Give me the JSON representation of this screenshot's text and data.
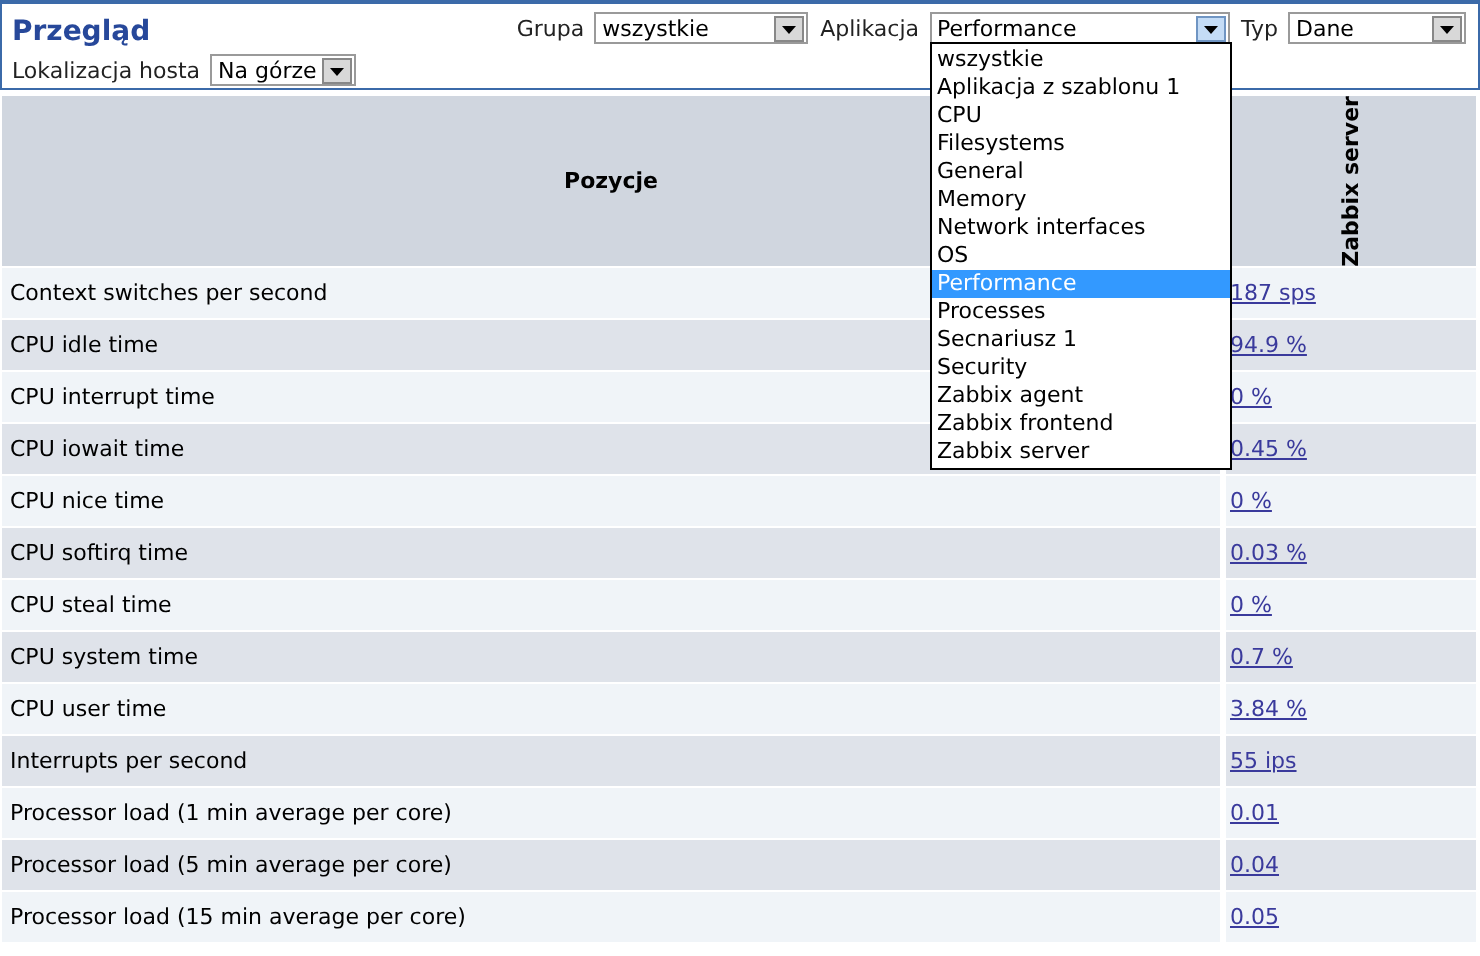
{
  "header": {
    "title": "Przegląd"
  },
  "filters": [
    {
      "label": "Grupa",
      "value": "wszystkie",
      "expanded": false
    },
    {
      "label": "Aplikacja",
      "value": "Performance",
      "expanded": true,
      "options": [
        {
          "label": "wszystkie",
          "selected": false
        },
        {
          "label": "Aplikacja z szablonu 1",
          "selected": false
        },
        {
          "label": "CPU",
          "selected": false
        },
        {
          "label": "Filesystems",
          "selected": false
        },
        {
          "label": "General",
          "selected": false
        },
        {
          "label": "Memory",
          "selected": false
        },
        {
          "label": "Network interfaces",
          "selected": false
        },
        {
          "label": "OS",
          "selected": false
        },
        {
          "label": "Performance",
          "selected": true
        },
        {
          "label": "Processes",
          "selected": false
        },
        {
          "label": "Secnariusz 1",
          "selected": false
        },
        {
          "label": "Security",
          "selected": false
        },
        {
          "label": "Zabbix agent",
          "selected": false
        },
        {
          "label": "Zabbix frontend",
          "selected": false
        },
        {
          "label": "Zabbix server",
          "selected": false
        }
      ]
    },
    {
      "label": "Typ",
      "value": "Dane",
      "expanded": false
    }
  ],
  "host_filters": [
    {
      "label": "Lokalizacja hosta",
      "value": "Na górze",
      "expanded": false
    }
  ],
  "table": {
    "columns": [
      "Pozycje",
      "Zabbix server"
    ],
    "rows": [
      {
        "item": "Context switches per second",
        "value": "187 sps"
      },
      {
        "item": "CPU idle time",
        "value": "94.9 %"
      },
      {
        "item": "CPU interrupt time",
        "value": "0 %"
      },
      {
        "item": "CPU iowait time",
        "value": "0.45 %"
      },
      {
        "item": "CPU nice time",
        "value": "0 %"
      },
      {
        "item": "CPU softirq time",
        "value": "0.03 %"
      },
      {
        "item": "CPU steal time",
        "value": "0 %"
      },
      {
        "item": "CPU system time",
        "value": "0.7 %"
      },
      {
        "item": "CPU user time",
        "value": "3.84 %"
      },
      {
        "item": "Interrupts per second",
        "value": "55 ips"
      },
      {
        "item": "Processor load (1 min average per core)",
        "value": "0.01"
      },
      {
        "item": "Processor load (5 min average per core)",
        "value": "0.04"
      },
      {
        "item": "Processor load (15 min average per core)",
        "value": "0.05"
      }
    ]
  }
}
